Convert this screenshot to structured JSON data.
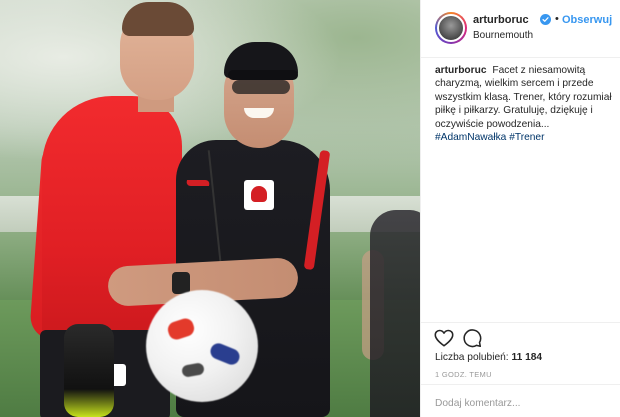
{
  "post": {
    "username": "arturboruc",
    "separator": "•",
    "follow_label": "Obserwuj",
    "location": "Bournemouth",
    "caption": {
      "username": "arturboruc",
      "text": "Facet z niesamowitą charyzmą, wielkim sercem i przede wszystkim klasą. Trener, który rozumiał piłkę i piłkarzy. Gratuluję, dziękuję i oczywiście powodzenia...",
      "hashtags": [
        "#AdamNawałka",
        "#Trener"
      ]
    },
    "likes": {
      "label": "Liczba polubień:",
      "count": "11 184"
    },
    "timestamp": "1 GODZ. TEMU",
    "comment_placeholder": "Dodaj komentarz..."
  },
  "icons": {
    "verified": "verified-badge-icon",
    "like": "heart-icon",
    "comment": "comment-bubble-icon"
  },
  "colors": {
    "link": "#3897f0",
    "hashtag": "#003569",
    "text": "#262626",
    "muted": "#999999",
    "border": "#efefef"
  }
}
